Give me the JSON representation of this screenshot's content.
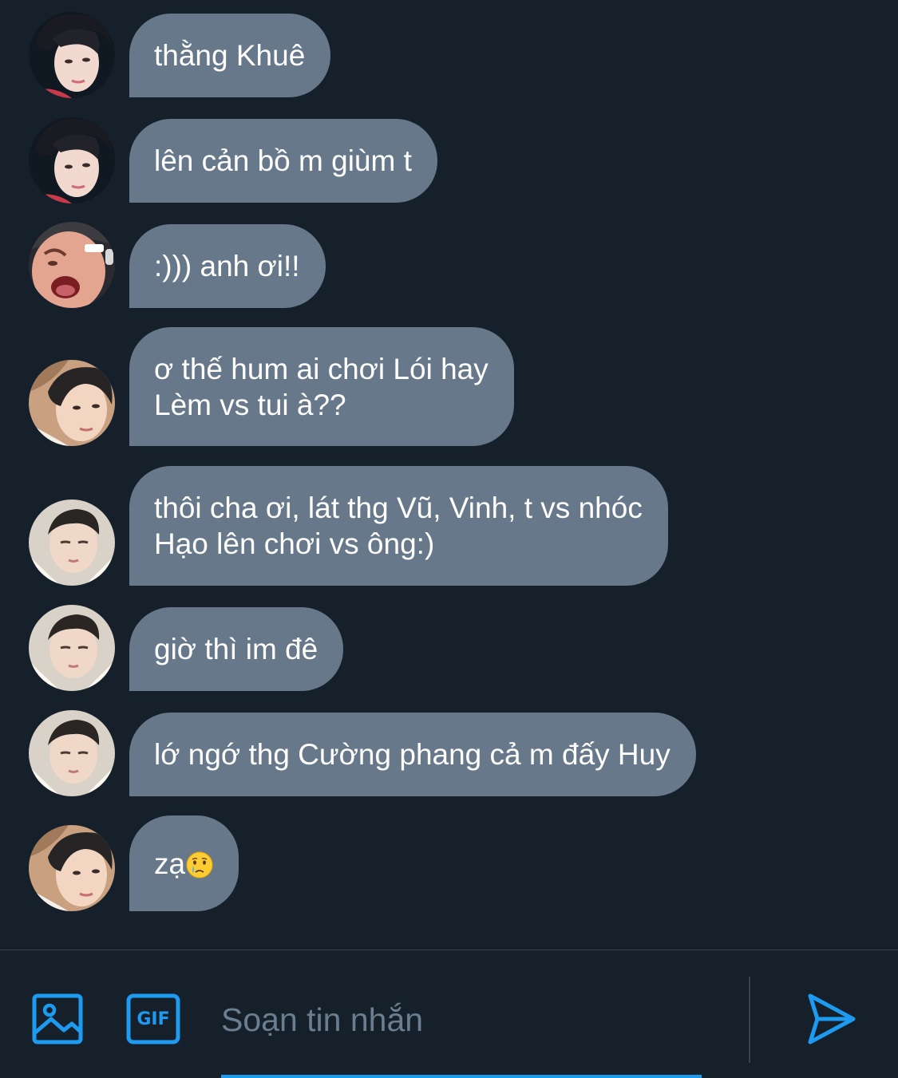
{
  "messages": [
    {
      "sender": "pink-hair",
      "lines": [
        "thằng Khuê"
      ]
    },
    {
      "sender": "pink-hair",
      "lines": [
        "lên cản bồ m giùm t"
      ]
    },
    {
      "sender": "shouting-guy",
      "lines": [
        ":))) anh ơi!!"
      ]
    },
    {
      "sender": "messy-hair",
      "lines": [
        "ơ thế hum ai chơi Lói hay",
        "Lèm vs tui à??"
      ]
    },
    {
      "sender": "pillow-guy",
      "lines": [
        "thôi cha ơi, lát thg Vũ, Vinh, t vs nhóc",
        "Hạo lên chơi vs ông:)"
      ]
    },
    {
      "sender": "pillow-guy",
      "lines": [
        "giờ thì im đê"
      ]
    },
    {
      "sender": "pillow-guy",
      "lines": [
        "lớ ngớ thg Cường phang cả m đấy Huy"
      ]
    },
    {
      "sender": "messy-hair",
      "lines": [
        "zạ"
      ],
      "emoji": "crying-face-icon"
    }
  ],
  "composer": {
    "placeholder": "Soạn tin nhắn",
    "image_button_icon": "image-icon",
    "gif_button_label": "GIF",
    "send_button_icon": "send-icon"
  },
  "colors": {
    "background": "#16202b",
    "bubble": "#66788a",
    "accent": "#1d9bf0",
    "placeholder": "#6b7e8f"
  }
}
